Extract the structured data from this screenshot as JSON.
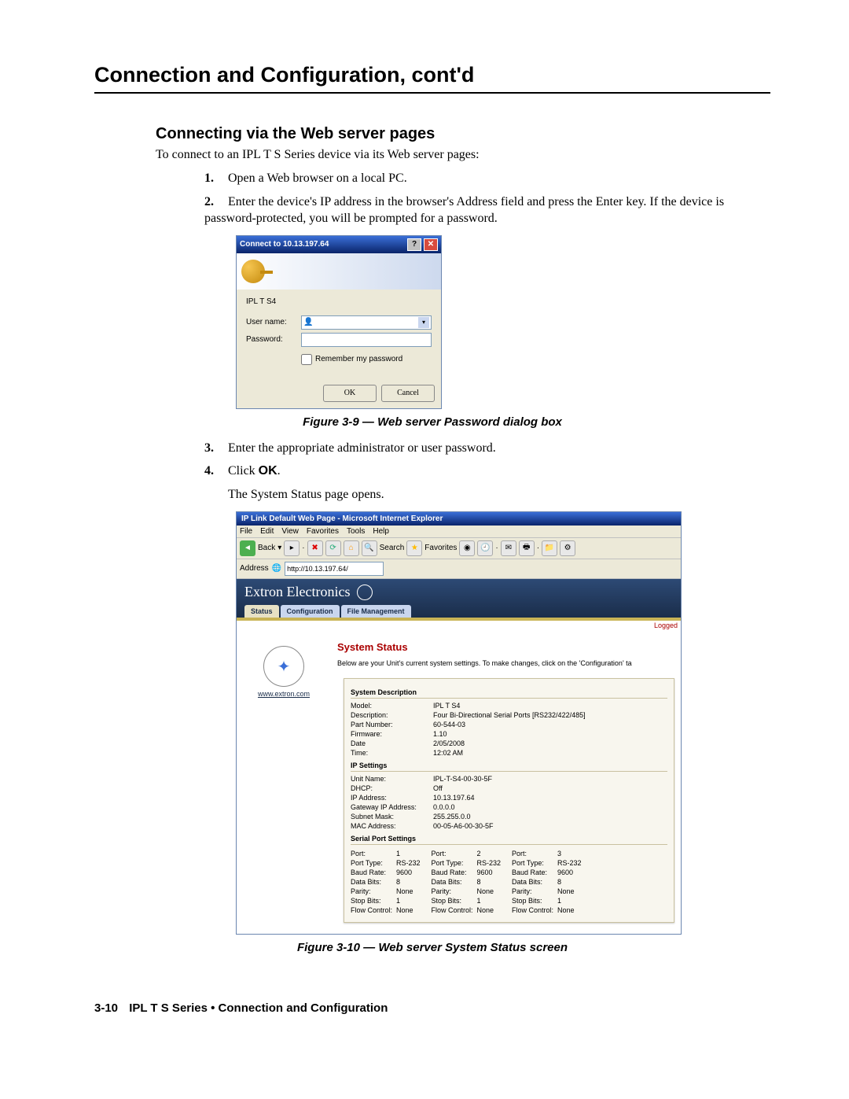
{
  "page": {
    "h1": "Connection and Configuration, cont'd",
    "h2": "Connecting via the Web server pages",
    "intro": "To connect to an IPL T S Series device via its Web server pages:",
    "step1": "Open a Web browser on a local PC.",
    "step2": "Enter the device's IP address in the browser's Address field and press the Enter key.  If the device is password-protected, you will be prompted for a password.",
    "caption1": "Figure 3-9 — Web server Password dialog box",
    "step3": "Enter the appropriate administrator or user password.",
    "step4a": "Click ",
    "step4b": "OK",
    "step4c": ".",
    "step_open": "The System Status page opens.",
    "caption2": "Figure 3-10 — Web server System Status screen",
    "footer_pg": "3-10",
    "footer_txt": "IPL T S Series • Connection and Configuration"
  },
  "dialog": {
    "title": "Connect to 10.13.197.64",
    "device": "IPL T S4",
    "user_label": "User name:",
    "pass_label": "Password:",
    "remember": "Remember my password",
    "ok": "OK",
    "cancel": "Cancel"
  },
  "ie": {
    "title": "IP Link Default Web Page - Microsoft Internet Explorer",
    "menu": {
      "file": "File",
      "edit": "Edit",
      "view": "View",
      "fav": "Favorites",
      "tools": "Tools",
      "help": "Help"
    },
    "tool_back": "Back",
    "tool_search": "Search",
    "tool_fav": "Favorites",
    "addr_label": "Address",
    "addr_value": "http://10.13.197.64/",
    "brand": "Extron  Electronics",
    "tabs": {
      "status": "Status",
      "config": "Configuration",
      "file": "File Management"
    },
    "logged": "Logged",
    "side_link": "www.extron.com",
    "ss_title": "System Status",
    "ss_desc": "Below are your Unit's current system settings. To make changes, click on the 'Configuration' ta",
    "sect1": "System Description",
    "sysd": {
      "model_k": "Model:",
      "model_v": "IPL T S4",
      "desc_k": "Description:",
      "desc_v": "Four Bi-Directional Serial Ports [RS232/422/485]",
      "part_k": "Part Number:",
      "part_v": "60-544-03",
      "fw_k": "Firmware:",
      "fw_v": "1.10",
      "date_k": "Date",
      "date_v": "2/05/2008",
      "time_k": "Time:",
      "time_v": "12:02 AM"
    },
    "sect2": "IP Settings",
    "ip": {
      "unit_k": "Unit Name:",
      "unit_v": "IPL-T-S4-00-30-5F",
      "dhcp_k": "DHCP:",
      "dhcp_v": "Off",
      "ip_k": "IP Address:",
      "ip_v": "10.13.197.64",
      "gw_k": "Gateway IP Address:",
      "gw_v": "0.0.0.0",
      "sn_k": "Subnet Mask:",
      "sn_v": "255.255.0.0",
      "mac_k": "MAC Address:",
      "mac_v": "00-05-A6-00-30-5F"
    },
    "sect3": "Serial Port Settings",
    "pl": {
      "port": "Port:",
      "ptype": "Port Type:",
      "baud": "Baud Rate:",
      "dbits": "Data Bits:",
      "parity": "Parity:",
      "sbits": "Stop Bits:",
      "flow": "Flow Control:"
    },
    "p1": {
      "n": "1",
      "t": "RS-232",
      "b": "9600",
      "d": "8",
      "p": "None",
      "s": "1",
      "f": "None"
    },
    "p2": {
      "n": "2",
      "t": "RS-232",
      "b": "9600",
      "d": "8",
      "p": "None",
      "s": "1",
      "f": "None"
    },
    "p3": {
      "n": "3",
      "t": "RS-232",
      "b": "9600",
      "d": "8",
      "p": "None",
      "s": "1",
      "f": "None"
    }
  }
}
